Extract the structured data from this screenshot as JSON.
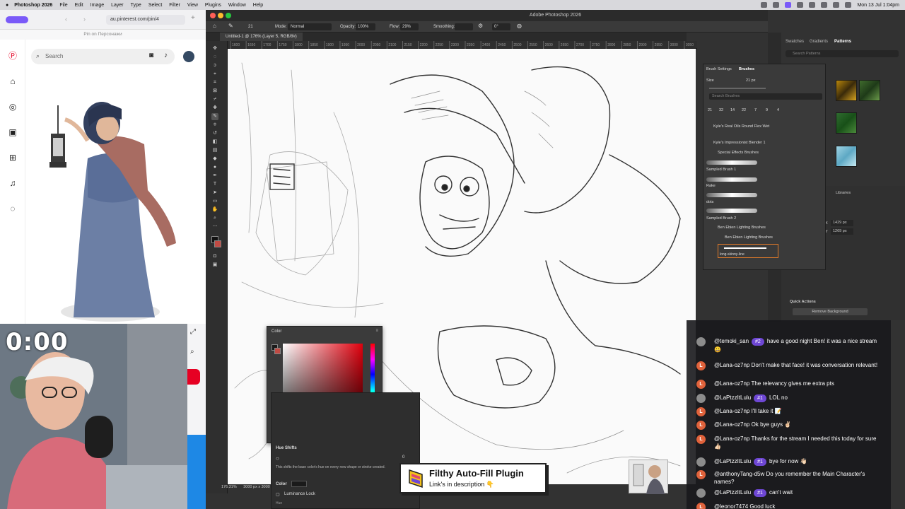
{
  "menubar": {
    "app": "Photoshop 2026",
    "items": [
      "File",
      "Edit",
      "Image",
      "Layer",
      "Type",
      "Select",
      "Filter",
      "View",
      "Plugins",
      "Window",
      "Help"
    ],
    "clock": "Mon 13 Jul 1:04pm"
  },
  "browser": {
    "url": "au.pinterest.com/pin/4",
    "subtitle": "Pin on Персонажи",
    "search_placeholder": "Search"
  },
  "webcam": {
    "timer": "0:00"
  },
  "photoshop": {
    "window_title": "Adobe Photoshop 2026",
    "doc_tab": "Untitled-1 @ 176% (Layer 5, RGB/8#)",
    "options": {
      "mode_label": "Mode:",
      "mode_value": "Normal",
      "opacity_label": "Opacity:",
      "opacity_value": "100%",
      "flow_label": "Flow:",
      "flow_value": "29%",
      "smoothing_label": "Smoothing:",
      "angle_value": "0°",
      "brush_size": "21"
    },
    "ruler_ticks": [
      "1600",
      "1650",
      "1700",
      "1750",
      "1800",
      "1850",
      "1900",
      "1950",
      "2000",
      "2050",
      "2100",
      "2150",
      "2200",
      "2250",
      "2300",
      "2350",
      "2400",
      "2450",
      "2500",
      "2550",
      "2600",
      "2650",
      "2700",
      "2750",
      "2800",
      "2850",
      "2900",
      "2950",
      "3000",
      "3050"
    ],
    "status_zoom": "176.31%",
    "status_info": "3000 px x 3000 px (72 ppi)"
  },
  "color_panel": {
    "title": "Color"
  },
  "props_panel": {
    "section": "Hue Shifts",
    "hue_value": "0",
    "description": "This shifts the base color's hue on every new shape or stroke created.",
    "color_label": "Color",
    "lum_lock": "Luminance Lock",
    "hue_label": "Hue"
  },
  "dock": {
    "tabs": [
      "Swatches",
      "Gradients",
      "Patterns"
    ],
    "pattern_search": "Search Patterns",
    "tabs2": [
      "Libraries"
    ],
    "quick_actions": "Quick Actions",
    "remove_bg": "Remove Background",
    "x_value": "1429 px",
    "y_value": "1269 px"
  },
  "brush_panel": {
    "tabs": [
      "Brush Settings",
      "Brushes"
    ],
    "size_label": "Size",
    "size_value": "21 px",
    "search": "Search Brushes",
    "preset_sizes": [
      "21",
      "32",
      "14",
      "22",
      "7",
      "9",
      "4"
    ],
    "items": [
      "Kyle's Real Oils Round Flex Wet",
      "Kyle's Impressionist Blender 1",
      "Special Effects Brushes",
      "Sampled Brush 1",
      "Rake",
      "dots",
      "Sampled Brush 2",
      "Ben Ebien Lighting Brushes",
      "Ben Ebien Lighting Brushes",
      "long-skinny-line"
    ]
  },
  "chat": {
    "messages": [
      {
        "user": "@temoki_san",
        "badge": "#2",
        "text": "have a good night Ben! it was a nice stream 😀"
      },
      {
        "user": "@Lana-oz7np",
        "badge": "",
        "text": "Don't make that face! it was conversation relevant!"
      },
      {
        "user": "@Lana-oz7np",
        "badge": "",
        "text": "The relevancy gives me extra pts"
      },
      {
        "user": "@LaPtzzItLulu",
        "badge": "#1",
        "text": "LOL no"
      },
      {
        "user": "@Lana-oz7np",
        "badge": "",
        "text": "I'll take it 📝"
      },
      {
        "user": "@Lana-oz7np",
        "badge": "",
        "text": "Ok bye guys ✌🏻"
      },
      {
        "user": "@Lana-oz7np",
        "badge": "",
        "text": "Thanks for the stream I needed this today for sure 👍🏻"
      },
      {
        "user": "@LaPtzzItLulu",
        "badge": "#1",
        "text": "bye for now 👋🏻"
      },
      {
        "user": "@anthonyTang-d5w",
        "badge": "",
        "text": "Do you remember the Main Character's names?"
      },
      {
        "user": "@LaPtzzItLulu",
        "badge": "#1",
        "text": "can't wait"
      },
      {
        "user": "@leonor7474",
        "badge": "",
        "text": "Good luck"
      }
    ]
  },
  "sticker": {
    "title": "Filthy Auto-Fill Plugin",
    "subtitle": "Link's in description 👇"
  },
  "colors": {
    "accent": "#6e47d4",
    "pinterest": "#e60023",
    "ps_bg": "#323232"
  }
}
